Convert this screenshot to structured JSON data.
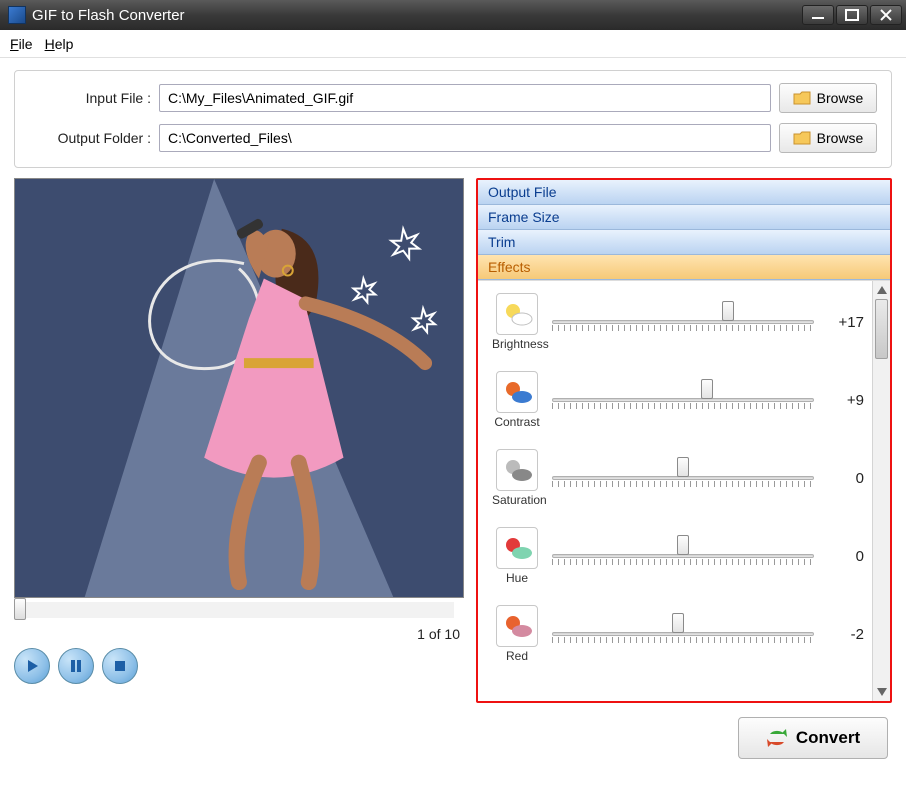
{
  "window": {
    "title": "GIF to Flash Converter"
  },
  "menu": {
    "file": "File",
    "help": "Help"
  },
  "form": {
    "input_label": "Input File :",
    "input_value": "C:\\My_Files\\Animated_GIF.gif",
    "output_label": "Output Folder :",
    "output_value": "C:\\Converted_Files\\",
    "browse": "Browse"
  },
  "preview": {
    "page_counter": "1 of 10"
  },
  "accordion": {
    "output_file": "Output File",
    "frame_size": "Frame Size",
    "trim": "Trim",
    "effects": "Effects"
  },
  "effects": [
    {
      "label": "Brightness",
      "value": "+17",
      "pos": 67
    },
    {
      "label": "Contrast",
      "value": "+9",
      "pos": 59
    },
    {
      "label": "Saturation",
      "value": "0",
      "pos": 50
    },
    {
      "label": "Hue",
      "value": "0",
      "pos": 50
    },
    {
      "label": "Red",
      "value": "-2",
      "pos": 48
    }
  ],
  "convert": "Convert"
}
